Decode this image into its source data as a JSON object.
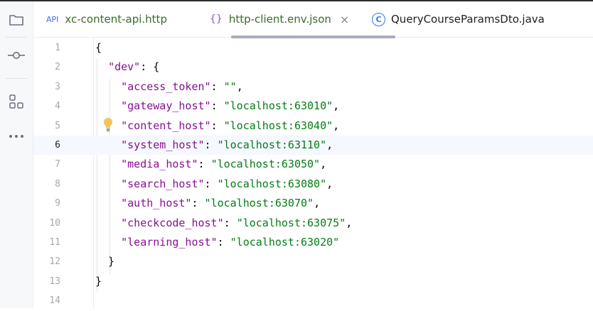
{
  "tabs": [
    {
      "icon": "API",
      "label": "xc-content-api.http",
      "active": false
    },
    {
      "icon": "{}",
      "label": "http-client.env.json",
      "active": true,
      "close": "×"
    },
    {
      "icon": "C",
      "label": "QueryCourseParamsDto.java",
      "active": false
    }
  ],
  "editor": {
    "current_line": 6,
    "line_numbers": [
      "1",
      "2",
      "3",
      "4",
      "5",
      "6",
      "7",
      "8",
      "9",
      "10",
      "11",
      "12",
      "13",
      "14"
    ],
    "env_name": "\"dev\"",
    "entries": [
      {
        "key": "\"access_token\"",
        "value": "\"\"",
        "sep": ","
      },
      {
        "key": "\"gateway_host\"",
        "value": "\"localhost:63010\"",
        "sep": ","
      },
      {
        "key": "\"content_host\"",
        "value": "\"localhost:63040\"",
        "sep": ","
      },
      {
        "key": "\"system_host\"",
        "value": "\"localhost:63110\"",
        "sep": ","
      },
      {
        "key": "\"media_host\"",
        "value": "\"localhost:63050\"",
        "sep": ","
      },
      {
        "key": "\"search_host\"",
        "value": "\"localhost:63080\"",
        "sep": ","
      },
      {
        "key": "\"auth_host\"",
        "value": "\"localhost:63070\"",
        "sep": ","
      },
      {
        "key": "\"checkcode_host\"",
        "value": "\"localhost:63075\"",
        "sep": ","
      },
      {
        "key": "\"learning_host\"",
        "value": "\"localhost:63020\"",
        "sep": ""
      }
    ]
  },
  "colors": {
    "key": "#871094",
    "string": "#067d17",
    "bulb": "#f2c55c"
  },
  "icons": [
    "folder-icon",
    "commit-icon",
    "structure-icon",
    "more-icon",
    "lightbulb-icon"
  ]
}
